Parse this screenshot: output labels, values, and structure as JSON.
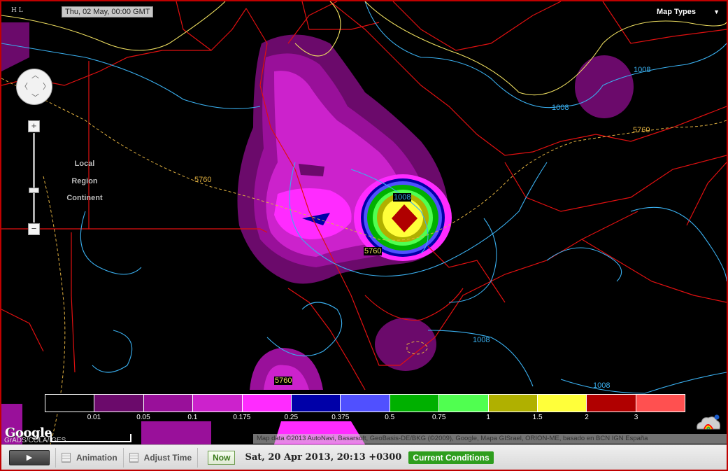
{
  "map": {
    "timestamp": "Thu, 02 May, 00:00 GMT",
    "ml_icon": "H L",
    "map_types_label": "Map Types",
    "level_labels": [
      "Local",
      "Region",
      "Continent"
    ],
    "contour_labels": [
      {
        "text": "1008",
        "kind": "pressure"
      },
      {
        "text": "1008",
        "kind": "pressure"
      },
      {
        "text": "1008",
        "kind": "pressure"
      },
      {
        "text": "1008",
        "kind": "pressure"
      },
      {
        "text": "1008",
        "kind": "pressure"
      },
      {
        "text": "5760",
        "kind": "height"
      },
      {
        "text": "5760",
        "kind": "height"
      },
      {
        "text": "5760",
        "kind": "height"
      },
      {
        "text": "5760",
        "kind": "height"
      }
    ],
    "legend": {
      "colors": [
        "#000000",
        "#6b0a6b",
        "#99109a",
        "#cc22cc",
        "#ff2bff",
        "#0000a8",
        "#5050ff",
        "#00b000",
        "#50ff50",
        "#b0b000",
        "#ffff3a",
        "#b00000",
        "#ff5050"
      ],
      "ticks": [
        "0.01",
        "0.05",
        "0.1",
        "0.175",
        "0.25",
        "0.375",
        "0.5",
        "0.75",
        "1",
        "1.5",
        "2",
        "3"
      ]
    },
    "google_logo": "Google",
    "scale_text": "GrADS/COLA/IGES",
    "attribution": "Map data ©2013 AutoNavi, Basarsoft, GeoBasis-DE/BKG (©2009), Google, Mapa GISrael, ORION-ME, basado en BCN IGN España"
  },
  "toolbar": {
    "play_label": "▶",
    "animation_label": "Animation",
    "adjust_time_label": "Adjust Time",
    "now_label": "Now",
    "datetime": "Sat, 20 Apr 2013, 20:13 +0300",
    "current_conditions_label": "Current Conditions"
  },
  "colors": {
    "border": "#c00000",
    "pressure_contour": "#3ab0f0",
    "height_contour": "#f0c040",
    "boundary": "#e01010"
  }
}
